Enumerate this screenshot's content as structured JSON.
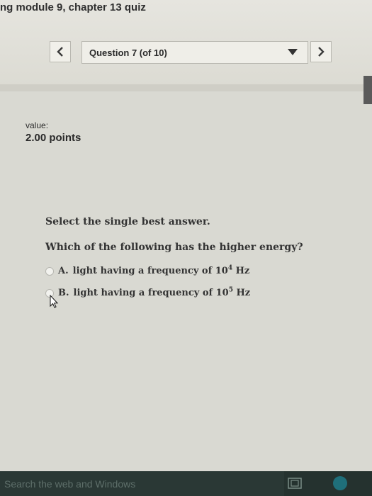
{
  "header": {
    "quiz_title": "ng module 9, chapter 13 quiz"
  },
  "nav": {
    "prev_icon": "chevron-left-icon",
    "question_selector_label": "Question 7 (of 10)",
    "dropdown_icon": "caret-down-icon",
    "next_icon": "chevron-right-icon"
  },
  "score": {
    "label": "value:",
    "points": "2.00 points"
  },
  "question": {
    "instruction": "Select the single best answer.",
    "prompt": "Which of the following has the higher energy?",
    "options": [
      {
        "letter": "A.",
        "text": "light having a frequency of 10",
        "exponent": "4",
        "unit": "Hz"
      },
      {
        "letter": "B.",
        "text": "light having a frequency of 10",
        "exponent": "5",
        "unit": "Hz"
      }
    ]
  },
  "taskbar": {
    "search_placeholder": "Search the web and Windows",
    "task_view_icon": "task-view-icon",
    "browser_icon": "edge-browser-icon"
  },
  "colors": {
    "page_background": "#d9d9d2",
    "taskbar": "#25322f",
    "text": "#2a2a2a"
  }
}
